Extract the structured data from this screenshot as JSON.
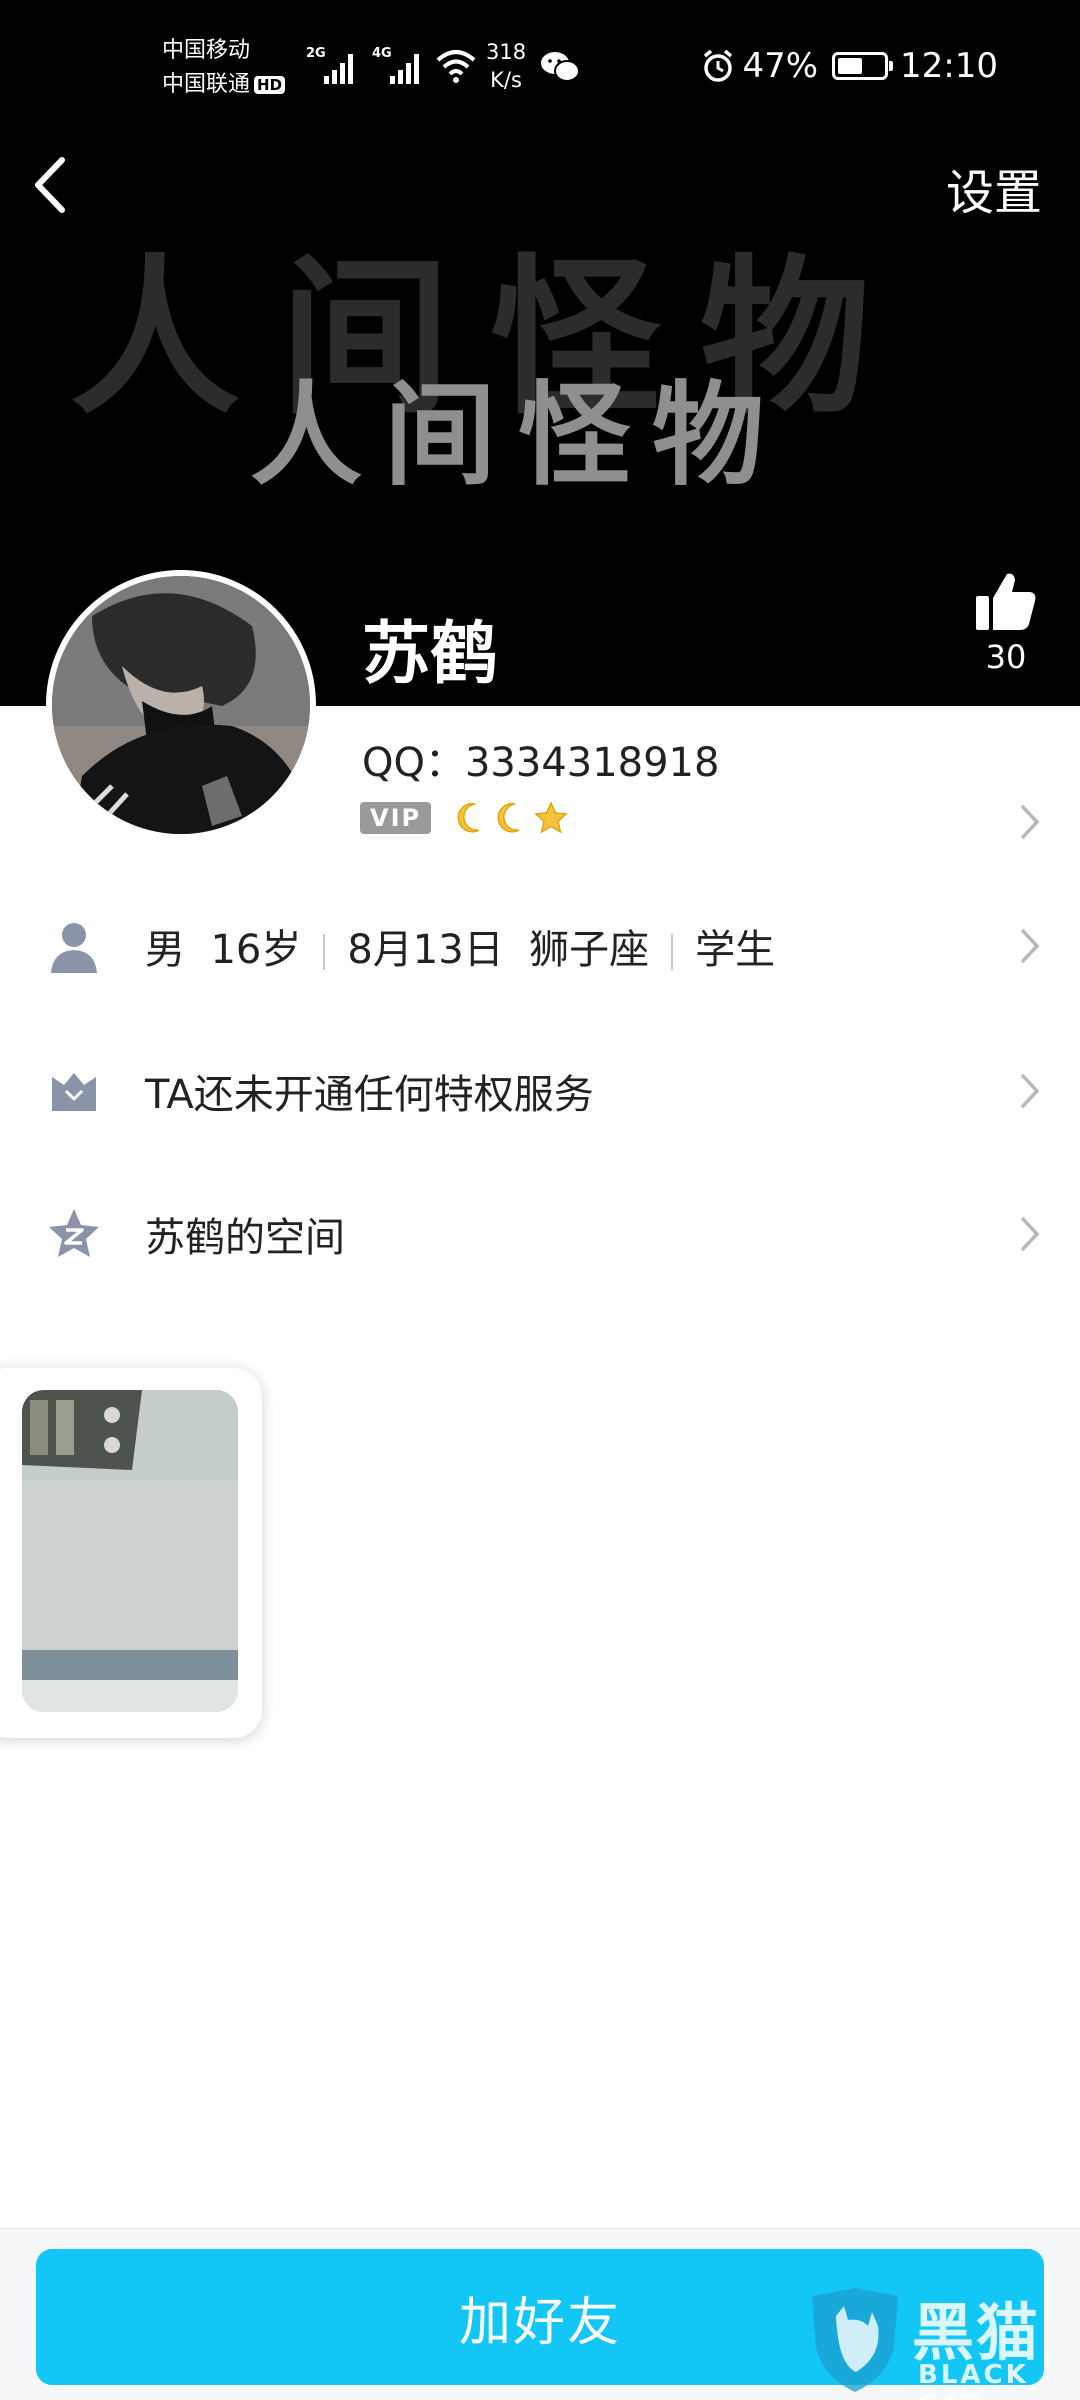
{
  "status_bar": {
    "carrier_1": "中国移动",
    "carrier_2": "中国联通",
    "hd_badge": "HD",
    "signal_1_tag": "2G",
    "signal_2_tag": "4G",
    "speed_value": "318",
    "speed_unit": "K/s",
    "battery_text": "47%",
    "battery_level": 0.47,
    "time": "12:10",
    "icons": [
      "signal-icon",
      "wifi-icon",
      "wechat-icon",
      "alarm-icon",
      "battery-icon"
    ]
  },
  "header": {
    "settings_label": "设置",
    "cover_text_bg": "人间怪物",
    "cover_text_fg": "人间怪物",
    "nickname": "苏鹤",
    "like_count": "30"
  },
  "profile": {
    "qq_line": "QQ：3334318918",
    "vip_label": "VIP"
  },
  "info_rows": {
    "basic": {
      "gender": "男",
      "age": "16岁",
      "birthday": "8月13日",
      "zodiac": "狮子座",
      "occupation": "学生"
    },
    "privilege": "TA还未开通任何特权服务",
    "space": "苏鹤的空间"
  },
  "footer": {
    "add_friend_label": "加好友"
  },
  "watermark": {
    "name": "黑猫",
    "sub": "BLACK CAT"
  },
  "colors": {
    "accent_button": "#12c7f6",
    "header_bg": "#000000",
    "icon_gray": "#8a93a8",
    "chevron": "#b8b8b8"
  }
}
